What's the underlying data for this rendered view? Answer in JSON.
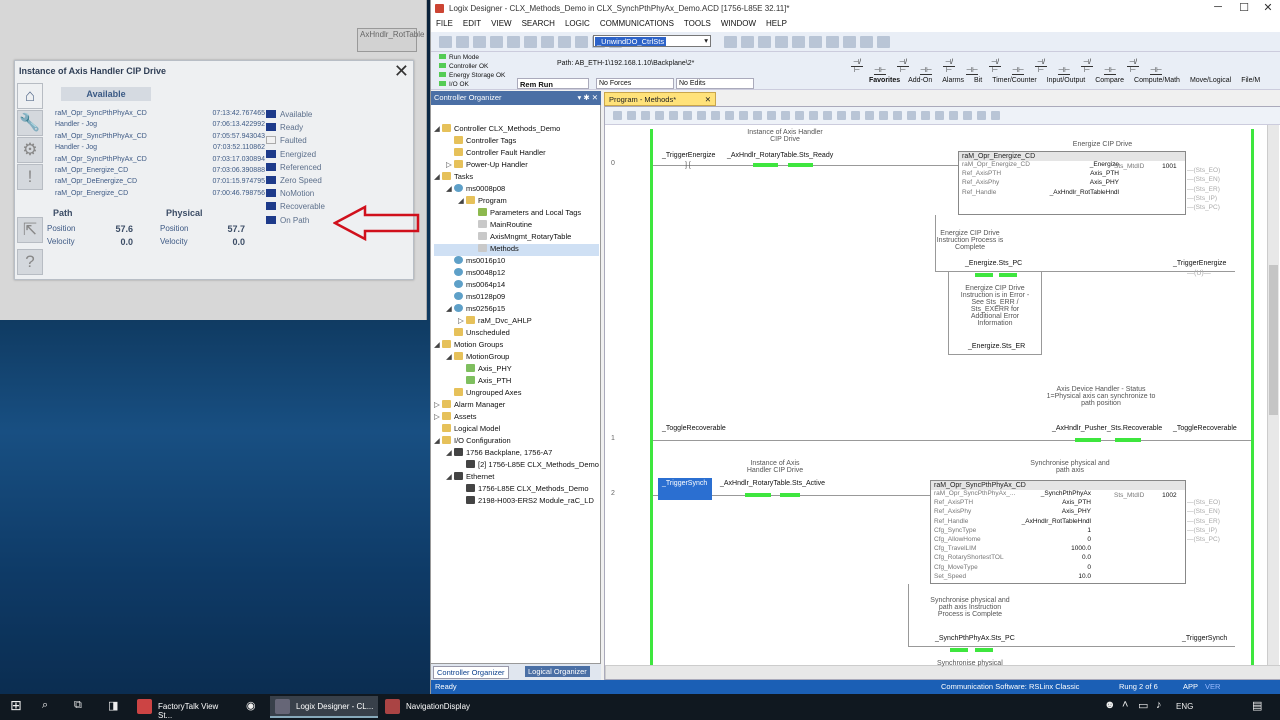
{
  "ghost": {
    "text": "AxHndlr_RotTable"
  },
  "faceplate": {
    "title": "Instance of Axis Handler CIP Drive",
    "available": "Available",
    "events": [
      {
        "name": "raM_Opr_SyncPthPhyAx_CD",
        "time": "07:13:42.767465"
      },
      {
        "name": "Handler - Jog",
        "time": "07:06:13.422992"
      },
      {
        "name": "raM_Opr_SyncPthPhyAx_CD",
        "time": "07:05:57.943043"
      },
      {
        "name": "Handler - Jog",
        "time": "07:03:52.110862"
      },
      {
        "name": "raM_Opr_SyncPthPhyAx_CD",
        "time": "07:03:17.030894"
      },
      {
        "name": "raM_Opr_Energize_CD",
        "time": "07:03:06.390888"
      },
      {
        "name": "raM_Opr_DeEnergize_CD",
        "time": "07:01:15.974795"
      },
      {
        "name": "raM_Opr_Energize_CD",
        "time": "07:00:46.798756"
      }
    ],
    "states": [
      {
        "label": "Available",
        "on": true
      },
      {
        "label": "Ready",
        "on": true
      },
      {
        "label": "Faulted",
        "on": false
      },
      {
        "label": "Energized",
        "on": true
      },
      {
        "label": "Referenced",
        "on": true
      },
      {
        "label": "Zero Speed",
        "on": true
      },
      {
        "label": "NoMotion",
        "on": true
      },
      {
        "label": "Recoverable",
        "on": true
      },
      {
        "label": "On Path",
        "on": true
      }
    ],
    "path_hdr": "Path",
    "phys_hdr": "Physical",
    "pos_label": "Position",
    "vel_label": "Velocity",
    "path_pos": "57.6",
    "path_vel": "0.0",
    "phys_pos": "57.7",
    "phys_vel": "0.0"
  },
  "logix": {
    "title": "Logix Designer - CLX_Methods_Demo in CLX_SynchPthPhyAx_Demo.ACD [1756-L85E 32.11]*",
    "menu": [
      "FILE",
      "EDIT",
      "VIEW",
      "SEARCH",
      "LOGIC",
      "COMMUNICATIONS",
      "TOOLS",
      "WINDOW",
      "HELP"
    ],
    "combo": "_UnwindDO_CtrlSts",
    "status": [
      "Run Mode",
      "Controller OK",
      "Energy Storage OK",
      "I/O OK"
    ],
    "run": "Rem Run",
    "path": "Path:  AB_ETH-1\\192.168.1.10\\Backplane\\2*",
    "forces": "No Forces",
    "edits": "No Edits",
    "instr_tabs": [
      "Favorites",
      "Add-On",
      "Alarms",
      "Bit",
      "Timer/Counter",
      "Input/Output",
      "Compare",
      "Compute/Math",
      "Move/Logical",
      "File/M"
    ],
    "organizer": "Controller Organizer",
    "tree": [
      {
        "d": 0,
        "ex": "◢",
        "ic": "fold",
        "t": "Controller CLX_Methods_Demo"
      },
      {
        "d": 1,
        "ex": "",
        "ic": "fold",
        "t": "Controller Tags"
      },
      {
        "d": 1,
        "ex": "",
        "ic": "fold",
        "t": "Controller Fault Handler"
      },
      {
        "d": 1,
        "ex": "▷",
        "ic": "fold",
        "t": "Power-Up Handler"
      },
      {
        "d": 0,
        "ex": "◢",
        "ic": "fold",
        "t": "Tasks"
      },
      {
        "d": 1,
        "ex": "◢",
        "ic": "clk",
        "t": "ms0008p08"
      },
      {
        "d": 2,
        "ex": "◢",
        "ic": "fold",
        "t": "Program"
      },
      {
        "d": 3,
        "ex": "",
        "ic": "tag",
        "t": "Parameters and Local Tags"
      },
      {
        "d": 3,
        "ex": "",
        "ic": "lad",
        "t": "MainRoutine"
      },
      {
        "d": 3,
        "ex": "",
        "ic": "lad",
        "t": "AxisMngmt_RotaryTable"
      },
      {
        "d": 3,
        "ex": "",
        "ic": "lad",
        "t": "Methods",
        "sel": true
      },
      {
        "d": 1,
        "ex": "",
        "ic": "clk",
        "t": "ms0016p10"
      },
      {
        "d": 1,
        "ex": "",
        "ic": "clk",
        "t": "ms0048p12"
      },
      {
        "d": 1,
        "ex": "",
        "ic": "clk",
        "t": "ms0064p14"
      },
      {
        "d": 1,
        "ex": "",
        "ic": "clk",
        "t": "ms0128p09"
      },
      {
        "d": 1,
        "ex": "◢",
        "ic": "clk",
        "t": "ms0256p15"
      },
      {
        "d": 2,
        "ex": "▷",
        "ic": "fold",
        "t": "raM_Dvc_AHLP"
      },
      {
        "d": 1,
        "ex": "",
        "ic": "fold",
        "t": "Unscheduled"
      },
      {
        "d": 0,
        "ex": "◢",
        "ic": "fold",
        "t": "Motion Groups"
      },
      {
        "d": 1,
        "ex": "◢",
        "ic": "fold",
        "t": "MotionGroup"
      },
      {
        "d": 2,
        "ex": "",
        "ic": "ax",
        "t": "Axis_PHY"
      },
      {
        "d": 2,
        "ex": "",
        "ic": "ax",
        "t": "Axis_PTH"
      },
      {
        "d": 1,
        "ex": "",
        "ic": "fold",
        "t": "Ungrouped Axes"
      },
      {
        "d": 0,
        "ex": "▷",
        "ic": "fold",
        "t": "Alarm Manager"
      },
      {
        "d": 0,
        "ex": "▷",
        "ic": "fold",
        "t": "Assets"
      },
      {
        "d": 0,
        "ex": "",
        "ic": "fold",
        "t": "Logical Model"
      },
      {
        "d": 0,
        "ex": "◢",
        "ic": "fold",
        "t": "I/O Configuration"
      },
      {
        "d": 1,
        "ex": "◢",
        "ic": "dev",
        "t": "1756 Backplane, 1756-A7"
      },
      {
        "d": 2,
        "ex": "",
        "ic": "dev",
        "t": "[2] 1756-L85E CLX_Methods_Demo"
      },
      {
        "d": 1,
        "ex": "◢",
        "ic": "dev",
        "t": "Ethernet"
      },
      {
        "d": 2,
        "ex": "",
        "ic": "dev",
        "t": "1756-L85E CLX_Methods_Demo"
      },
      {
        "d": 2,
        "ex": "",
        "ic": "dev",
        "t": "2198-H003-ERS2 Module_raC_LD"
      }
    ],
    "org_tab1": "Controller Organizer",
    "org_tab2": "Logical Organizer",
    "prog_tab": "Program - Methods*",
    "statusbar": {
      "left": "Ready",
      "comm": "Communication Software: RSLinx Classic",
      "rung": "Rung 2 of 6",
      "app": "APP",
      "ver": "VER"
    }
  },
  "ladder": {
    "r0": {
      "num": "0",
      "xic": "_TriggerEnergize",
      "cmt": "Instance of Axis Handler CIP Drive",
      "tag": "_AxHndlr_RotaryTable.Sts_Ready",
      "blk": "raM_Opr_Energize_CD",
      "rows": [
        [
          "raM_Opr_Energize_CD",
          "_Energize"
        ],
        [
          "Ref_AxisPTH",
          "Axis_PTH"
        ],
        [
          "Ref_AxisPhy",
          "Axis_PHY"
        ],
        [
          "Ref_Handle",
          "_AxHndlr_RotTableHndl"
        ]
      ],
      "mtdid": "Sts_MtdID",
      "mtdval": "1001",
      "outs": [
        "Sts_EO",
        "Sts_EN",
        "Sts_ER",
        "Sts_IP",
        "Sts_PC"
      ],
      "hdr": "Energize CIP Drive",
      "cmt2": "Energize CIP Drive Instruction Process is Complete",
      "tag2": "_Energize.Sts_PC",
      "coil": "_TriggerEnergize",
      "cmt3": "Energize CIP Drive Instruction is in Error - See Sts_ERR / Sts_EXERR for Additional Error Information",
      "tag3": "_Energize.Sts_ER"
    },
    "r1": {
      "num": "1",
      "xic": "_ToggleRecoverable",
      "cmt": "Axis Device Handler - Status 1=Physical axis can synchronize to path position",
      "tag": "_AxHndlr_Pusher_Sts.Recoverable",
      "coil": "_ToggleRecoverable"
    },
    "r2": {
      "num": "2",
      "xic": "_TriggerSynch",
      "cmt": "Instance of Axis Handler CIP Drive",
      "tag": "_AxHndlr_RotaryTable.Sts_Active",
      "hdr": "Synchronise physical and path axis",
      "blk": "raM_Opr_SyncPthPhyAx_CD",
      "rows": [
        [
          "raM_Opr_SyncPthPhyAx_...",
          "_SynchPthPhyAx"
        ],
        [
          "Ref_AxisPTH",
          "Axis_PTH"
        ],
        [
          "Ref_AxisPhy",
          "Axis_PHY"
        ],
        [
          "Ref_Handle",
          "_AxHndlr_RotTableHndl"
        ],
        [
          "Cfg_SyncType",
          "1"
        ],
        [
          "Cfg_AllowHome",
          "0"
        ],
        [
          "Cfg_TravelLIM",
          "1000.0"
        ],
        [
          "Cfg_RotaryShortestTOL",
          "0.0"
        ],
        [
          "Cfg_MoveType",
          "0"
        ],
        [
          "Set_Speed",
          "10.0"
        ]
      ],
      "mtdid": "Sts_MtdID",
      "mtdval": "1002",
      "outs": [
        "Sts_EO",
        "Sts_EN",
        "Sts_ER",
        "Sts_IP",
        "Sts_PC"
      ],
      "cmt2": "Synchronise physical and path axis Instruction Process is Complete",
      "tag2": "_SynchPthPhyAx.Sts_PC",
      "coil": "_TriggerSynch",
      "cmt3": "Synchronise physical"
    }
  },
  "taskbar": {
    "apps": [
      "FactoryTalk View St...",
      "Logix Designer - CL...",
      "NavigationDisplay"
    ],
    "lang": "ENG"
  }
}
